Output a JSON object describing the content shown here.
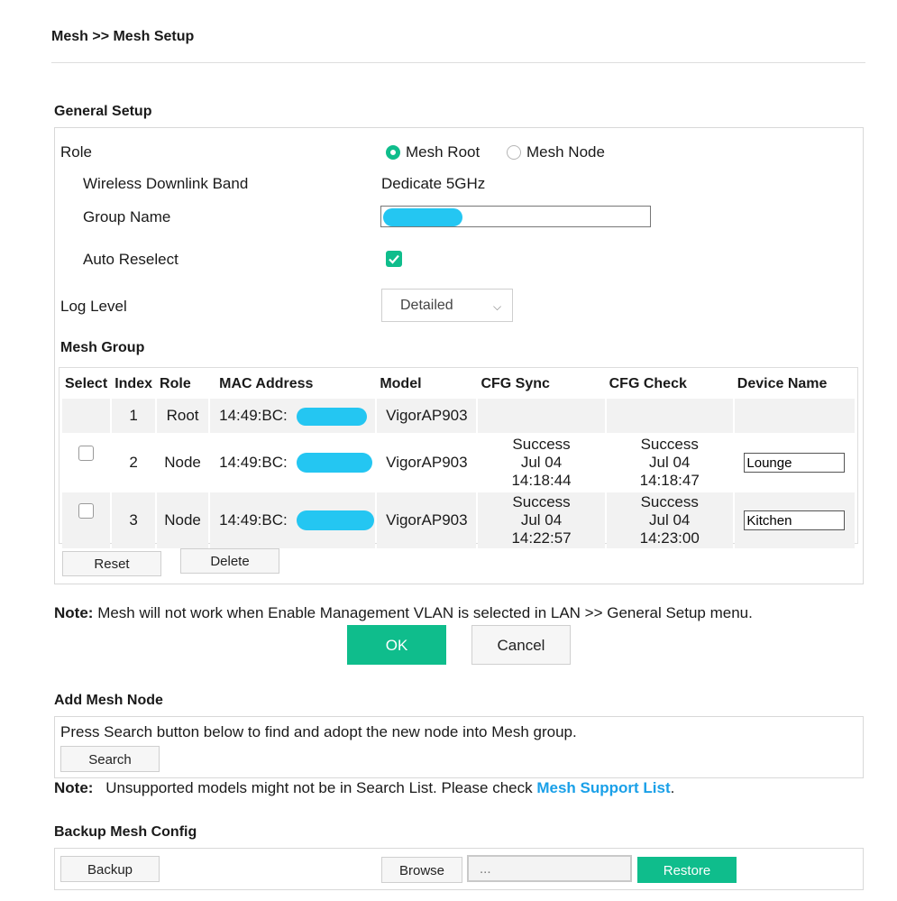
{
  "breadcrumb": "Mesh >> Mesh Setup",
  "general_setup": {
    "title": "General Setup",
    "role_label": "Role",
    "role_options": [
      "Mesh Root",
      "Mesh Node"
    ],
    "role_selected": "Mesh Root",
    "downlink_label": "Wireless Downlink Band",
    "downlink_value": "Dedicate 5GHz",
    "group_name_label": "Group Name",
    "group_name_value": "",
    "auto_reselect_label": "Auto Reselect",
    "auto_reselect_checked": true,
    "log_level_label": "Log Level",
    "log_level_value": "Detailed"
  },
  "mesh_group": {
    "title": "Mesh Group",
    "columns": [
      "Select",
      "Index",
      "Role",
      "MAC Address",
      "Model",
      "CFG Sync",
      "CFG Check",
      "Device Name"
    ],
    "rows": [
      {
        "index": "1",
        "role": "Root",
        "mac": "14:49:BC:",
        "model": "VigorAP903",
        "sync": [
          "",
          "",
          ""
        ],
        "check": [
          "",
          "",
          ""
        ],
        "device_name": ""
      },
      {
        "index": "2",
        "role": "Node",
        "mac": "14:49:BC:",
        "model": "VigorAP903",
        "sync": [
          "Success",
          "Jul 04",
          "14:18:44"
        ],
        "check": [
          "Success",
          "Jul 04",
          "14:18:47"
        ],
        "device_name": "Lounge"
      },
      {
        "index": "3",
        "role": "Node",
        "mac": "14:49:BC:",
        "model": "VigorAP903",
        "sync": [
          "Success",
          "Jul 04",
          "14:22:57"
        ],
        "check": [
          "Success",
          "Jul 04",
          "14:23:00"
        ],
        "device_name": "Kitchen"
      }
    ],
    "reset_label": "Reset",
    "delete_label": "Delete"
  },
  "note1": {
    "label": "Note",
    "sep": ":",
    "text": "Mesh will not work when Enable Management VLAN is selected in LAN >> General Setup menu."
  },
  "ok_label": "OK",
  "cancel_label": "Cancel",
  "add_node": {
    "title": "Add Mesh Node",
    "text": "Press Search button below to find and adopt the new node into Mesh group.",
    "search_label": "Search"
  },
  "note2": {
    "label": "Note:",
    "text": "Unsupported models might not be in Search List. Please check ",
    "link": "Mesh Support List",
    "end": "."
  },
  "backup": {
    "title": "Backup Mesh Config",
    "backup_label": "Backup",
    "browse_label": "Browse",
    "file_placeholder": "...",
    "restore_label": "Restore"
  },
  "colors": {
    "accent": "#0fbd8c",
    "link": "#1aa0e8",
    "redaction": "#24c6f2"
  }
}
